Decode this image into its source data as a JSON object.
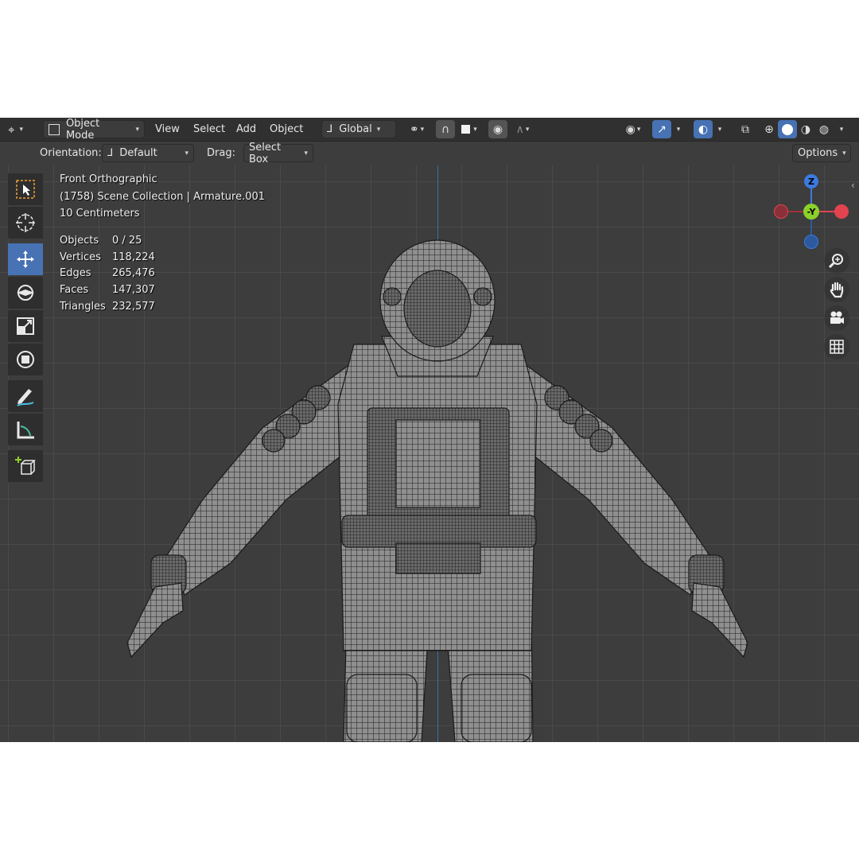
{
  "header": {
    "mode_label": "Object Mode",
    "menu": [
      "View",
      "Select",
      "Add",
      "Object"
    ],
    "transform_orientation": "Global"
  },
  "tool_settings": {
    "orientation_label": "Orientation:",
    "orientation_value": "Default",
    "drag_label": "Drag:",
    "drag_value": "Select Box",
    "options_label": "Options"
  },
  "overlay": {
    "view_name": "Front Orthographic",
    "collection_info": "(1758) Scene Collection | Armature.001",
    "scale_info": "10 Centimeters",
    "stats": [
      {
        "label": "Objects",
        "value": "0 / 25"
      },
      {
        "label": "Vertices",
        "value": "118,224"
      },
      {
        "label": "Edges",
        "value": "265,476"
      },
      {
        "label": "Faces",
        "value": "147,307"
      },
      {
        "label": "Triangles",
        "value": "232,577"
      }
    ]
  },
  "gizmo": {
    "z": "Z",
    "y": "-Y"
  },
  "tools": [
    "select-box-tool",
    "cursor-tool",
    "move-tool",
    "rotate-tool",
    "scale-tool",
    "transform-tool",
    "annotate-tool",
    "measure-tool",
    "add-cube-tool"
  ],
  "colors": {
    "accent": "#4772b3",
    "x_axis": "#e2434f",
    "y_axis": "#8bd12a",
    "z_axis": "#3c7ae0",
    "viewport_bg": "#3d3d3d",
    "header_bg": "#303030"
  }
}
